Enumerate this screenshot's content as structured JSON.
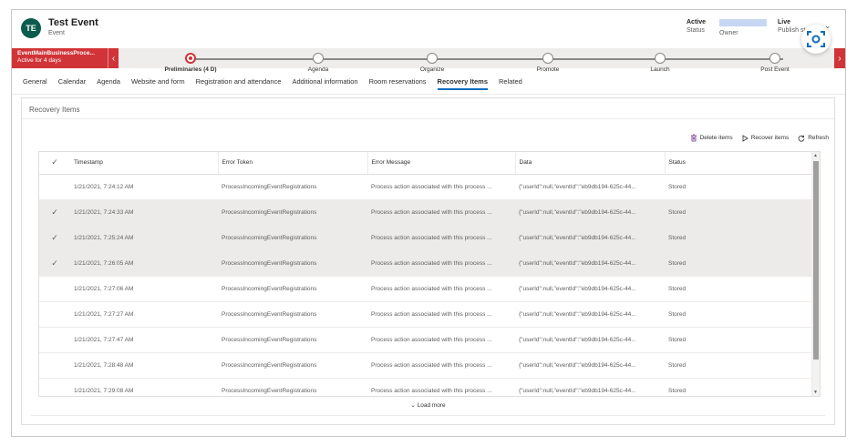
{
  "header": {
    "avatar_initials": "TE",
    "title": "Test Event",
    "entity_type": "Event",
    "status_value": "Active",
    "status_label": "Status",
    "owner_label": "Owner",
    "publish_value": "Live",
    "publish_label": "Publish st..."
  },
  "process": {
    "flag_name": "EventMainBusinessProce...",
    "flag_sub": "Active for 4 days",
    "stages": [
      {
        "label": "Preliminaries  (4 D)",
        "active": true
      },
      {
        "label": "Agenda",
        "active": false
      },
      {
        "label": "Organize",
        "active": false
      },
      {
        "label": "Promote",
        "active": false
      },
      {
        "label": "Launch",
        "active": false
      },
      {
        "label": "Post Event",
        "active": false
      }
    ]
  },
  "tabs": [
    "General",
    "Calendar",
    "Agenda",
    "Website and form",
    "Registration and attendance",
    "Additional information",
    "Room reservations",
    "Recovery Items",
    "Related"
  ],
  "active_tab": "Recovery Items",
  "section": {
    "title": "Recovery Items",
    "commands": {
      "delete": "Delete items",
      "recover": "Recover items",
      "refresh": "Refresh"
    }
  },
  "grid": {
    "columns": [
      "Timestamp",
      "Error Token",
      "Error Message",
      "Data",
      "Status"
    ],
    "rows": [
      {
        "selected": false,
        "timestamp": "1/21/2021, 7:24:12 AM",
        "token": "ProcessIncomingEventRegistrations",
        "message": "Process action associated with this process ...",
        "data": "{\"userId\":null,\"eventId\":\"eb9db194-625c-44...",
        "status": "Stored"
      },
      {
        "selected": true,
        "timestamp": "1/21/2021, 7:24:33 AM",
        "token": "ProcessIncomingEventRegistrations",
        "message": "Process action associated with this process ...",
        "data": "{\"userId\":null,\"eventId\":\"eb9db194-625c-44...",
        "status": "Stored"
      },
      {
        "selected": true,
        "timestamp": "1/21/2021, 7:25:24 AM",
        "token": "ProcessIncomingEventRegistrations",
        "message": "Process action associated with this process ...",
        "data": "{\"userId\":null,\"eventId\":\"eb9db194-625c-44...",
        "status": "Stored"
      },
      {
        "selected": true,
        "timestamp": "1/21/2021, 7:26:05 AM",
        "token": "ProcessIncomingEventRegistrations",
        "message": "Process action associated with this process ...",
        "data": "{\"userId\":null,\"eventId\":\"eb9db194-625c-44...",
        "status": "Stored"
      },
      {
        "selected": false,
        "timestamp": "1/21/2021, 7:27:06 AM",
        "token": "ProcessIncomingEventRegistrations",
        "message": "Process action associated with this process ...",
        "data": "{\"userId\":null,\"eventId\":\"eb9db194-625c-44...",
        "status": "Stored"
      },
      {
        "selected": false,
        "timestamp": "1/21/2021, 7:27:27 AM",
        "token": "ProcessIncomingEventRegistrations",
        "message": "Process action associated with this process ...",
        "data": "{\"userId\":null,\"eventId\":\"eb9db194-625c-44...",
        "status": "Stored"
      },
      {
        "selected": false,
        "timestamp": "1/21/2021, 7:27:47 AM",
        "token": "ProcessIncomingEventRegistrations",
        "message": "Process action associated with this process ...",
        "data": "{\"userId\":null,\"eventId\":\"eb9db194-625c-44...",
        "status": "Stored"
      },
      {
        "selected": false,
        "timestamp": "1/21/2021, 7:28:48 AM",
        "token": "ProcessIncomingEventRegistrations",
        "message": "Process action associated with this process ...",
        "data": "{\"userId\":null,\"eventId\":\"eb9db194-625c-44...",
        "status": "Stored"
      },
      {
        "selected": false,
        "timestamp": "1/21/2021, 7:29:08 AM",
        "token": "ProcessIncomingEventRegistrations",
        "message": "Process action associated with this process ...",
        "data": "{\"userId\":null,\"eventId\":\"eb9db194-625c-44...",
        "status": "Stored"
      }
    ],
    "load_more": "Load more"
  },
  "colors": {
    "accent": "#d13438",
    "avatar": "#0b5c4c",
    "tab_underline": "#0f6cbd",
    "selected_row": "#edebe9"
  },
  "icons": [
    "trash-icon",
    "play-icon",
    "refresh-icon",
    "checkmark-icon",
    "chevron-down-icon",
    "camera-scan-icon"
  ]
}
